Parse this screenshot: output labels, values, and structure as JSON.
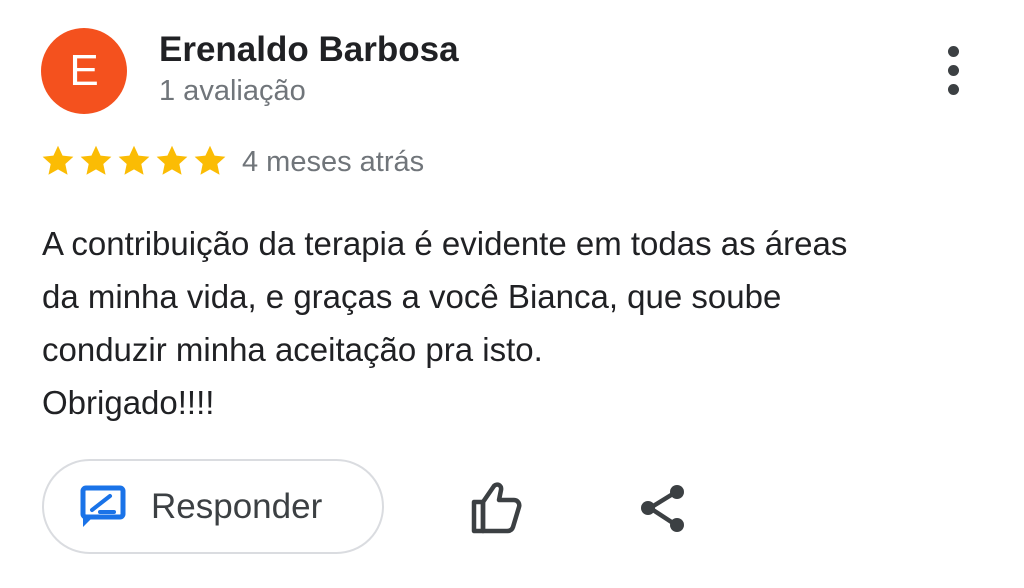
{
  "reviewer": {
    "initial": "E",
    "name": "Erenaldo Barbosa",
    "review_count": "1 avaliação",
    "avatar_color": "#f4511e"
  },
  "rating": {
    "stars": 5,
    "max": 5,
    "star_color": "#fbbc04",
    "time_ago": "4 meses atrás"
  },
  "review": {
    "lines": [
      "A contribuição da terapia é evidente em todas as áreas",
      "da minha vida, e graças a você Bianca, que soube",
      "conduzir minha aceitação pra isto.",
      "Obrigado!!!!"
    ]
  },
  "actions": {
    "reply_label": "Responder",
    "reply_icon": "reply-edit-icon",
    "like_icon": "thumb-up-icon",
    "share_icon": "share-icon",
    "more_icon": "more-vert-icon",
    "accent_color": "#1a73e8"
  }
}
